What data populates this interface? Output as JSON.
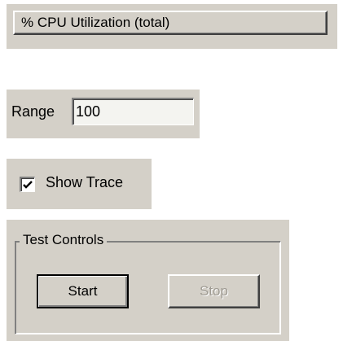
{
  "header": {
    "title": "% CPU Utilization (total)"
  },
  "range": {
    "label": "Range",
    "value": "100"
  },
  "trace": {
    "label": "Show Trace",
    "checked": true
  },
  "test_controls": {
    "title": "Test Controls",
    "start_label": "Start",
    "stop_label": "Stop",
    "stop_enabled": false
  },
  "colors": {
    "face": "#d4d0c8",
    "disabled_text": "#9e9a92",
    "input_bg": "#f4f4f0"
  }
}
